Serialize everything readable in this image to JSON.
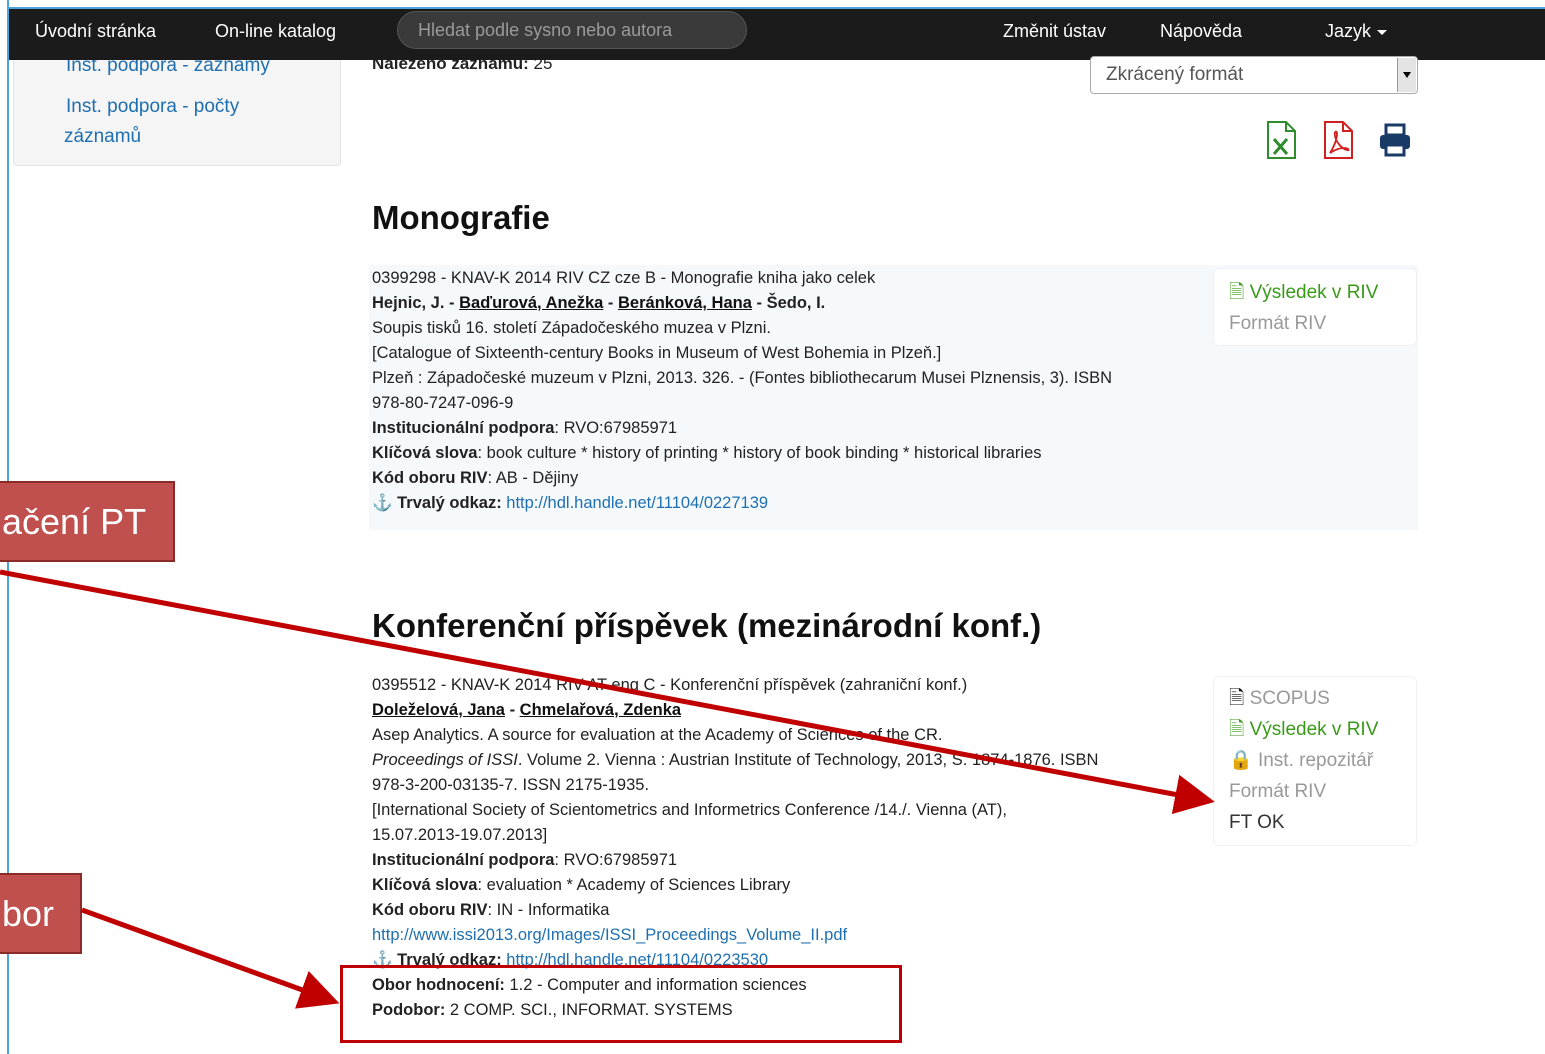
{
  "nav": {
    "home": "Úvodní stránka",
    "catalog": "On-line katalog",
    "search_placeholder": "Hledat podle sysno nebo autora",
    "change_institute": "Změnit ústav",
    "help": "Nápověda",
    "language": "Jazyk"
  },
  "sidebar": {
    "items": [
      {
        "label": "Inst. podpora - záznamy"
      },
      {
        "label": "Inst. podpora - počty"
      },
      {
        "label": "záznamů"
      }
    ]
  },
  "results": {
    "found_label": "Nalezeno záznamů:",
    "found_count": "25",
    "format_select": "Zkrácený formát",
    "export_icons": [
      "excel-icon",
      "pdf-icon",
      "print-icon"
    ]
  },
  "sections": [
    {
      "heading": "Monografie",
      "record": {
        "line1": "0399298 - KNAV-K 2014 RIV CZ cze B - Monografie kniha jako celek",
        "authors": [
          "Hejnic, J.",
          "Baďurová, Anežka",
          "Beránková, Hana",
          "Šedo, I."
        ],
        "title": "Soupis tisků 16. století Západočeského muzea v Plzni.",
        "translated": "[Catalogue of Sixteenth-century Books in Museum of West Bohemia in Plzeň.]",
        "publication_1": "Plzeň : Západočeské muzeum v Plzni, 2013. 326. - (Fontes bibliothecarum Musei Plznensis, 3). ISBN",
        "publication_2": "978-80-7247-096-9",
        "support_label": "Institucionální podpora",
        "support_value": ": RVO:67985971",
        "keywords_label": "Klíčová slova",
        "keywords_value": ": book culture * history of printing * history of book binding * historical libraries",
        "riv_label": "Kód oboru RIV",
        "riv_value": ": AB - Dějiny",
        "permalink_label": "Trvalý odkaz:",
        "permalink_url": "http://hdl.handle.net/11104/0227139"
      },
      "side": {
        "riv_result": "Výsledek v RIV",
        "riv_format": "Formát RIV"
      }
    },
    {
      "heading": "Konferenční příspěvek (mezinárodní konf.)",
      "record": {
        "line1": "0395512 - KNAV-K 2014 RIV AT eng C - Konferenční příspěvek (zahraniční konf.)",
        "authors": [
          "Doleželová, Jana",
          "Chmelařová, Zdenka"
        ],
        "title": "Asep Analytics. A source for evaluation at the Academy of Sciences of the CR.",
        "publication_italic": "Proceedings of ISSI",
        "publication_1": ". Volume 2. Vienna : Austrian Institute of Technology, 2013, S. 1874-1876. ISBN",
        "publication_2": "978-3-200-03135-7. ISSN 2175-1935.",
        "conference_1": "[International Society of Scientometrics and Informetrics Conference /14./. Vienna (AT),",
        "conference_2": "15.07.2013-19.07.2013]",
        "support_label": "Institucionální podpora",
        "support_value": ": RVO:67985971",
        "keywords_label": "Klíčová slova",
        "keywords_value": ": evaluation * Academy of Sciences Library",
        "riv_label": "Kód oboru RIV",
        "riv_value": ": IN - Informatika",
        "fulltext_url": "http://www.issi2013.org/Images/ISSI_Proceedings_Volume_II.pdf",
        "permalink_label": "Trvalý odkaz:",
        "permalink_url": "http://hdl.handle.net/11104/0223530",
        "eval_label": "Obor hodnocení:",
        "eval_value": "1.2 - Computer and information sciences",
        "subfield_label": "Podobor:",
        "subfield_value": "2 COMP. SCI., INFORMAT. SYSTEMS"
      },
      "side": {
        "scopus": "SCOPUS",
        "riv_result": "Výsledek v RIV",
        "repository": "Inst. repozitář",
        "riv_format": "Formát RIV",
        "ft_status": "FT OK"
      }
    }
  ],
  "annotations": {
    "callout_1": "ačení PT",
    "callout_2": "bor"
  },
  "colors": {
    "navbar": "#1b1b1b",
    "link": "#1f6fb0",
    "green": "#3a9a1a",
    "callout": "#c0504d",
    "arrow": "#c00000"
  }
}
